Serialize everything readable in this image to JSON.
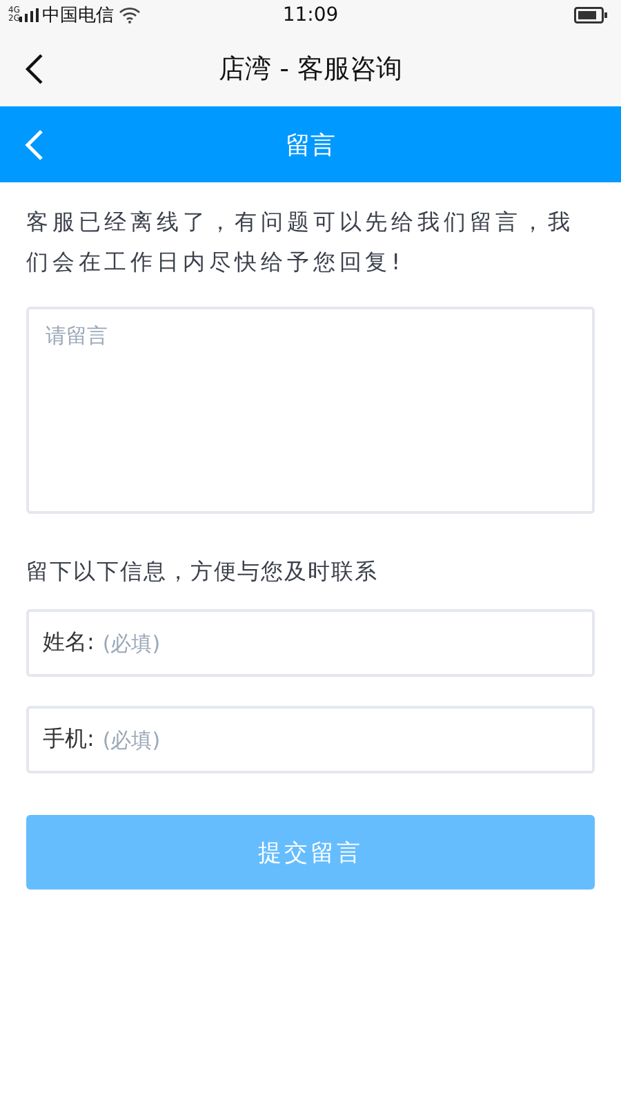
{
  "status_bar": {
    "network": [
      "4G",
      "2G"
    ],
    "carrier": "中国电信",
    "time": "11:09"
  },
  "nav_bar": {
    "title": "店湾 - 客服咨询"
  },
  "header": {
    "title": "留言"
  },
  "intro": "客服已经离线了，有问题可以先给我们留言，我们会在工作日内尽快给予您回复!",
  "message": {
    "placeholder": "请留言"
  },
  "contact_hint": "留下以下信息，方便与您及时联系",
  "fields": [
    {
      "label": "姓名:",
      "placeholder": "(必填)"
    },
    {
      "label": "手机:",
      "placeholder": "(必填)"
    }
  ],
  "submit": {
    "label": "提交留言",
    "disabled": true
  }
}
